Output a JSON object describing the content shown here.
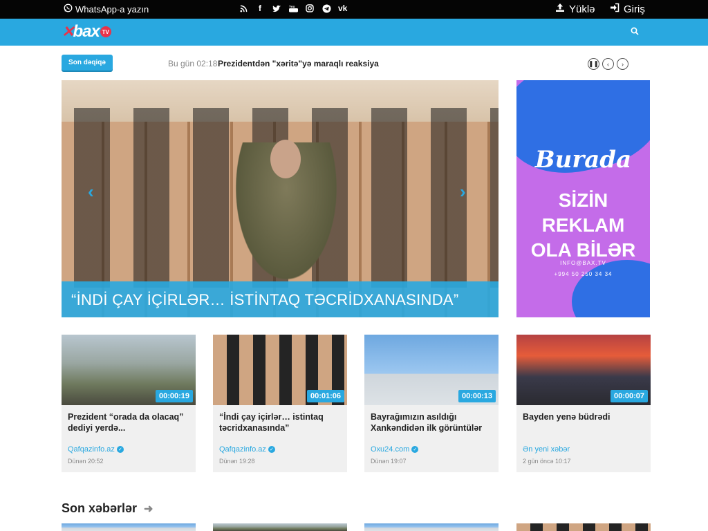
{
  "topbar": {
    "whatsapp_label": "WhatsApp-a yazın",
    "social_icons": [
      "rss-icon",
      "facebook-icon",
      "twitter-icon",
      "youtube-icon",
      "instagram-icon",
      "telegram-icon",
      "vk-icon"
    ],
    "upload_label": "Yüklə",
    "login_label": "Giriş"
  },
  "navbar": {
    "logo_text": "bax",
    "logo_badge": "TV",
    "accent_color": "#29a8e0"
  },
  "ticker": {
    "badge_label": "Son dəqiqə",
    "time": "Bu gün 02:18",
    "headline": "Prezidentdən \"xəritə\"yə maraqlı reaksiya"
  },
  "hero": {
    "caption": "“İNDİ ÇAY İÇİRLƏR… İSTİNTAQ TƏCRİDXANASINDA”"
  },
  "ad": {
    "line1": "Burada",
    "line2": "SİZİN REKLAM",
    "line3": "OLA BİLƏR",
    "email": "INFO@BAX.TV",
    "phone": "+994 50 250 34 34"
  },
  "videos": [
    {
      "duration": "00:00:19",
      "title": "Prezident “orada da olacaq” dediyi yerdə...",
      "source": "Qafqazinfo.az",
      "verified": true,
      "date": "Dünən 20:52"
    },
    {
      "duration": "00:01:06",
      "title": "“İndi çay içirlər… istintaq təcridxanasında”",
      "source": "Qafqazinfo.az",
      "verified": true,
      "date": "Dünən 19:28"
    },
    {
      "duration": "00:00:13",
      "title": "Bayrağımızın asıldığı Xankəndidən ilk görüntülər",
      "source": "Oxu24.com",
      "verified": true,
      "date": "Dünən 19:07"
    },
    {
      "duration": "00:00:07",
      "title": "Bayden yenə büdrədi",
      "source": "Ən yeni xəbər",
      "verified": false,
      "date": "2 gün öncə 10:17"
    }
  ],
  "latest_section": {
    "title": "Son xəbərlər"
  }
}
